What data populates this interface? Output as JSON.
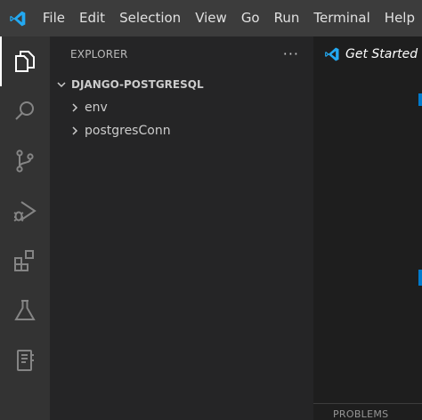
{
  "menu": {
    "items": [
      "File",
      "Edit",
      "Selection",
      "View",
      "Go",
      "Run",
      "Terminal",
      "Help"
    ]
  },
  "activity_bar": {
    "items": [
      {
        "icon": "files-icon",
        "active": true
      },
      {
        "icon": "search-icon",
        "active": false
      },
      {
        "icon": "source-control-icon",
        "active": false
      },
      {
        "icon": "run-debug-icon",
        "active": false
      },
      {
        "icon": "extensions-icon",
        "active": false
      },
      {
        "icon": "testing-icon",
        "active": false
      },
      {
        "icon": "notebook-icon",
        "active": false
      }
    ]
  },
  "sidebar": {
    "title": "EXPLORER",
    "more_actions": "···",
    "section": {
      "title": "DJANGO-POSTGRESQL",
      "items": [
        {
          "label": "env"
        },
        {
          "label": "postgresConn"
        }
      ]
    }
  },
  "editor": {
    "tab_label": "Get Started",
    "panel_tab": "PROBLEMS"
  },
  "colors": {
    "accent": "#007acc",
    "titlebar": "#3c3c3c",
    "activity_bar": "#333333",
    "sidebar": "#252526",
    "editor": "#1e1e1e"
  }
}
